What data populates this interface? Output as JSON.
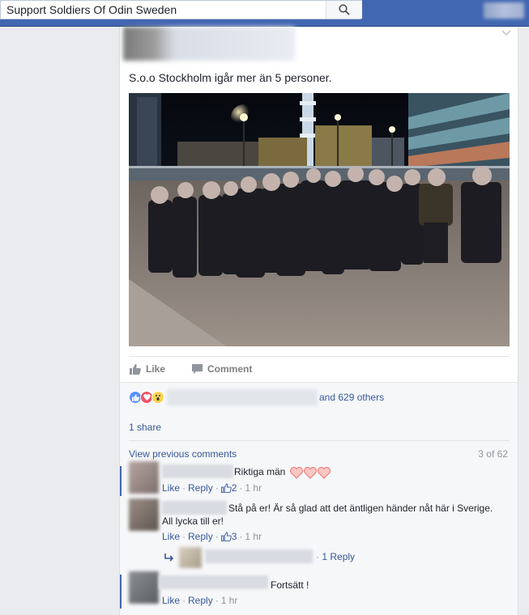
{
  "search": {
    "value": "Support Soldiers Of Odin Sweden"
  },
  "post": {
    "text": "S.o.o Stockholm igår mer än 5 personer.",
    "actions": {
      "like": "Like",
      "comment": "Comment"
    },
    "reactions_icons": [
      "like-icon",
      "love-icon",
      "wow-icon"
    ],
    "reactions_suffix": "and 629 others",
    "shares": "1 share",
    "view_previous": "View previous comments",
    "comment_count": "3 of 62"
  },
  "comments": [
    {
      "text": "Riktiga män",
      "like": "Like",
      "reply": "Reply",
      "likes": "2",
      "time": "1 hr",
      "emoji": "hearts-x3"
    },
    {
      "text": "Stå på er! Är så glad att det äntligen händer nåt här i Sverige.",
      "text2": "All lycka till er!",
      "like": "Like",
      "reply": "Reply",
      "likes": "3",
      "time": "1 hr",
      "replies": "1 Reply"
    },
    {
      "text": "Fortsätt !",
      "like": "Like",
      "reply": "Reply",
      "time": "1 hr"
    }
  ],
  "colors": {
    "topbar": "#4267b2",
    "link": "#365899",
    "meta": "#90949c",
    "heart": "#f25268"
  }
}
